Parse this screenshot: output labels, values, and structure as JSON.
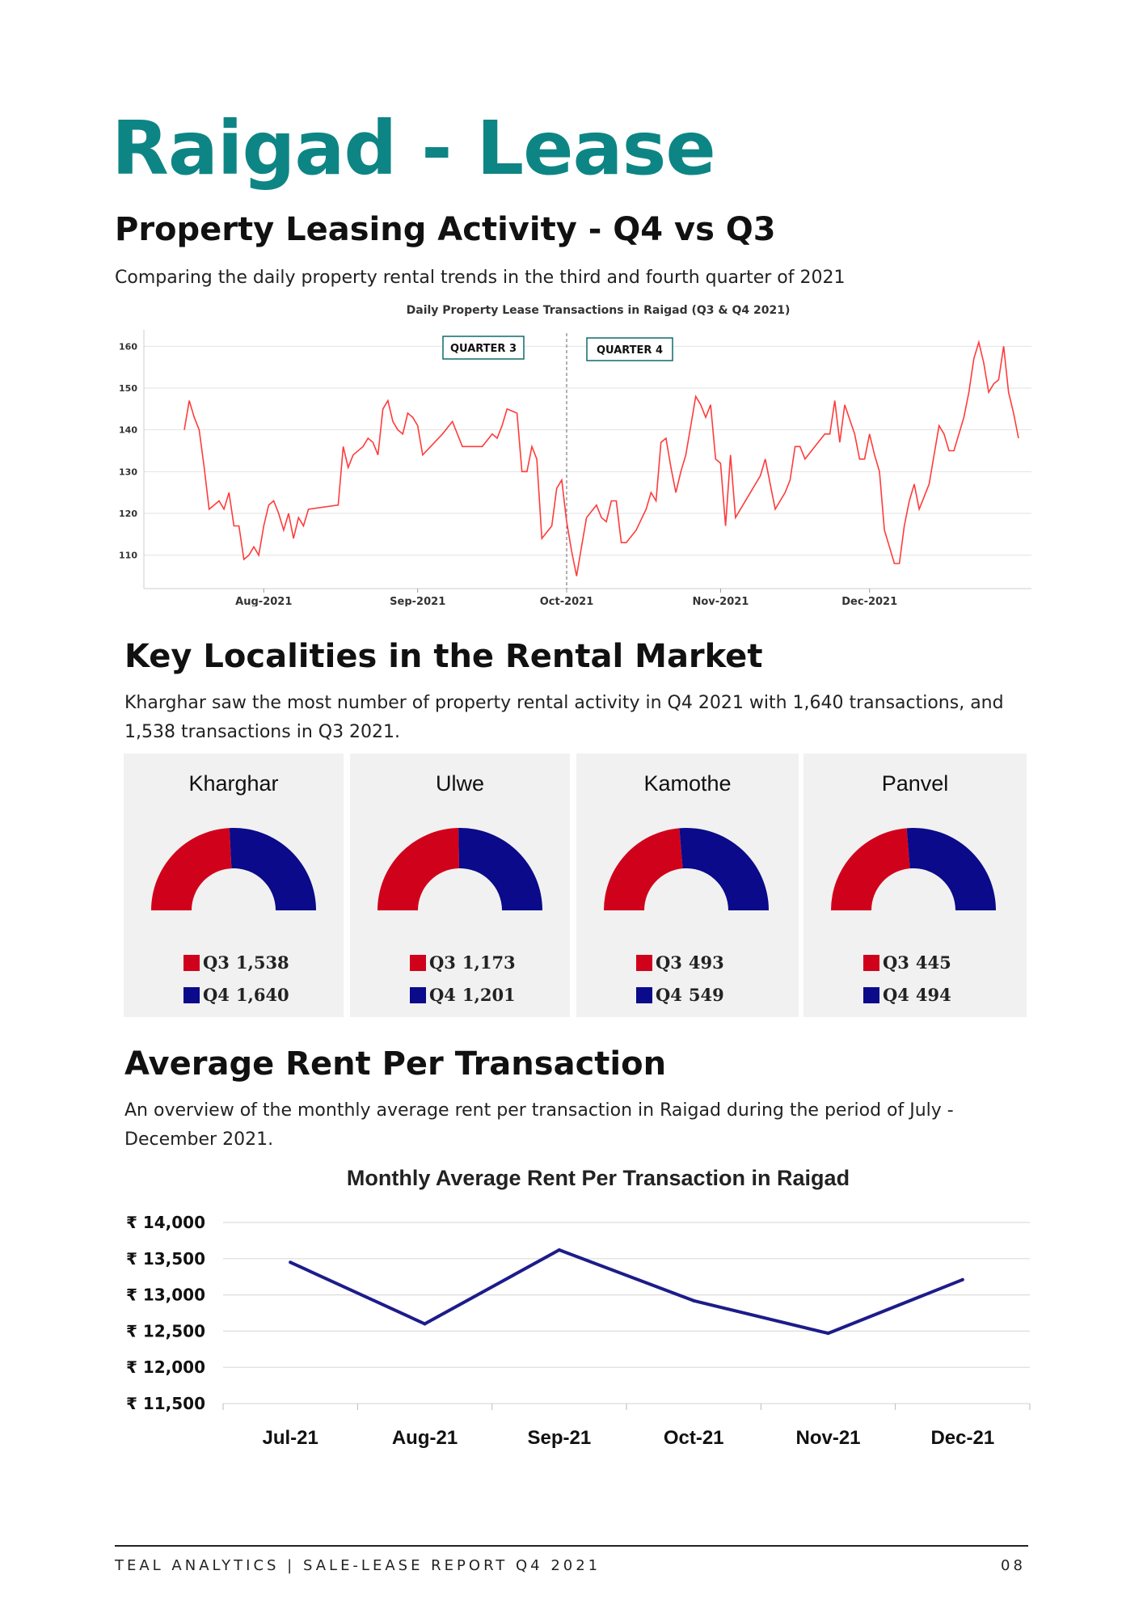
{
  "page": {
    "title": "Raigad - Lease",
    "footer_left": "TEAL ANALYTICS | SALE-LEASE REPORT Q4 2021",
    "page_number": "08",
    "accent_color": "#0e8585"
  },
  "section1": {
    "title": "Property Leasing Activity - Q4 vs Q3",
    "description": "Comparing the daily property rental trends in the third and fourth quarter of 2021"
  },
  "section2": {
    "title": "Key Localities in the Rental Market",
    "description": "Kharghar saw the most number of property rental activity in Q4 2021 with 1,640 transactions, and 1,538 transactions in Q3 2021."
  },
  "section3": {
    "title": "Average Rent Per Transaction",
    "description": "An overview of the monthly average rent per transaction in Raigad during the period of July - December 2021."
  },
  "localities": [
    {
      "name": "Kharghar",
      "q3_label": "Q3",
      "q4_label": "Q4",
      "q3_display": "1,538",
      "q4_display": "1,640",
      "q3": 1538,
      "q4": 1640
    },
    {
      "name": "Ulwe",
      "q3_label": "Q3",
      "q4_label": "Q4",
      "q3_display": "1,173",
      "q4_display": "1,201",
      "q3": 1173,
      "q4": 1201
    },
    {
      "name": "Kamothe",
      "q3_label": "Q3",
      "q4_label": "Q4",
      "q3_display": "493",
      "q4_display": "549",
      "q3": 493,
      "q4": 549
    },
    {
      "name": "Panvel",
      "q3_label": "Q3",
      "q4_label": "Q4",
      "q3_display": "445",
      "q4_display": "494",
      "q3": 445,
      "q4": 494
    }
  ],
  "chart_data": [
    {
      "type": "line",
      "title": "Daily Property Lease Transactions in Raigad (Q3 & Q4 2021)",
      "x_start": "2021-07-16",
      "x_end": "2021-12-31",
      "x_tick_labels": [
        "Aug-2021",
        "Sep-2021",
        "Oct-2021",
        "Nov-2021",
        "Dec-2021"
      ],
      "x_tick_dates": [
        "2021-08-01",
        "2021-09-01",
        "2021-10-01",
        "2021-11-01",
        "2021-12-01"
      ],
      "ylim": [
        102,
        162
      ],
      "yticks": [
        110,
        120,
        130,
        140,
        150,
        160
      ],
      "grid": true,
      "line_color": "#ff3b3b",
      "divider_date": "2021-10-01",
      "annotations": [
        "QUARTER 3",
        "QUARTER 4"
      ],
      "points": [
        [
          "2021-07-16",
          140
        ],
        [
          "2021-07-17",
          147
        ],
        [
          "2021-07-18",
          143
        ],
        [
          "2021-07-19",
          140
        ],
        [
          "2021-07-20",
          131
        ],
        [
          "2021-07-21",
          121
        ],
        [
          "2021-07-22",
          122
        ],
        [
          "2021-07-23",
          123
        ],
        [
          "2021-07-24",
          121
        ],
        [
          "2021-07-25",
          125
        ],
        [
          "2021-07-26",
          117
        ],
        [
          "2021-07-27",
          117
        ],
        [
          "2021-07-28",
          109
        ],
        [
          "2021-07-29",
          110
        ],
        [
          "2021-07-30",
          112
        ],
        [
          "2021-07-31",
          110
        ],
        [
          "2021-08-01",
          117
        ],
        [
          "2021-08-02",
          122
        ],
        [
          "2021-08-03",
          123
        ],
        [
          "2021-08-04",
          120
        ],
        [
          "2021-08-05",
          116
        ],
        [
          "2021-08-06",
          120
        ],
        [
          "2021-08-07",
          114
        ],
        [
          "2021-08-08",
          119
        ],
        [
          "2021-08-09",
          117
        ],
        [
          "2021-08-10",
          121
        ],
        [
          "2021-08-16",
          122
        ],
        [
          "2021-08-17",
          136
        ],
        [
          "2021-08-18",
          131
        ],
        [
          "2021-08-19",
          134
        ],
        [
          "2021-08-21",
          136
        ],
        [
          "2021-08-22",
          138
        ],
        [
          "2021-08-23",
          137
        ],
        [
          "2021-08-24",
          134
        ],
        [
          "2021-08-25",
          145
        ],
        [
          "2021-08-26",
          147
        ],
        [
          "2021-08-27",
          142
        ],
        [
          "2021-08-28",
          140
        ],
        [
          "2021-08-29",
          139
        ],
        [
          "2021-08-30",
          144
        ],
        [
          "2021-08-31",
          143
        ],
        [
          "2021-09-01",
          141
        ],
        [
          "2021-09-02",
          134
        ],
        [
          "2021-09-06",
          139
        ],
        [
          "2021-09-08",
          142
        ],
        [
          "2021-09-10",
          136
        ],
        [
          "2021-09-14",
          136
        ],
        [
          "2021-09-16",
          139
        ],
        [
          "2021-09-17",
          138
        ],
        [
          "2021-09-18",
          141
        ],
        [
          "2021-09-19",
          145
        ],
        [
          "2021-09-21",
          144
        ],
        [
          "2021-09-22",
          130
        ],
        [
          "2021-09-23",
          130
        ],
        [
          "2021-09-24",
          136
        ],
        [
          "2021-09-25",
          133
        ],
        [
          "2021-09-26",
          114
        ],
        [
          "2021-09-28",
          117
        ],
        [
          "2021-09-29",
          126
        ],
        [
          "2021-09-30",
          128
        ],
        [
          "2021-10-01",
          118
        ],
        [
          "2021-10-02",
          111
        ],
        [
          "2021-10-03",
          105
        ],
        [
          "2021-10-04",
          112
        ],
        [
          "2021-10-05",
          119
        ],
        [
          "2021-10-07",
          122
        ],
        [
          "2021-10-08",
          119
        ],
        [
          "2021-10-09",
          118
        ],
        [
          "2021-10-10",
          123
        ],
        [
          "2021-10-11",
          123
        ],
        [
          "2021-10-12",
          113
        ],
        [
          "2021-10-13",
          113
        ],
        [
          "2021-10-15",
          116
        ],
        [
          "2021-10-17",
          121
        ],
        [
          "2021-10-18",
          125
        ],
        [
          "2021-10-19",
          123
        ],
        [
          "2021-10-20",
          137
        ],
        [
          "2021-10-21",
          138
        ],
        [
          "2021-10-22",
          131
        ],
        [
          "2021-10-23",
          125
        ],
        [
          "2021-10-24",
          130
        ],
        [
          "2021-10-25",
          134
        ],
        [
          "2021-10-26",
          141
        ],
        [
          "2021-10-27",
          148
        ],
        [
          "2021-10-28",
          146
        ],
        [
          "2021-10-29",
          143
        ],
        [
          "2021-10-30",
          146
        ],
        [
          "2021-10-31",
          133
        ],
        [
          "2021-11-01",
          132
        ],
        [
          "2021-11-02",
          117
        ],
        [
          "2021-11-03",
          134
        ],
        [
          "2021-11-04",
          119
        ],
        [
          "2021-11-05",
          121
        ],
        [
          "2021-11-07",
          125
        ],
        [
          "2021-11-09",
          129
        ],
        [
          "2021-11-10",
          133
        ],
        [
          "2021-11-12",
          121
        ],
        [
          "2021-11-14",
          125
        ],
        [
          "2021-11-15",
          128
        ],
        [
          "2021-11-16",
          136
        ],
        [
          "2021-11-17",
          136
        ],
        [
          "2021-11-18",
          133
        ],
        [
          "2021-11-20",
          136
        ],
        [
          "2021-11-22",
          139
        ],
        [
          "2021-11-23",
          139
        ],
        [
          "2021-11-24",
          147
        ],
        [
          "2021-11-25",
          137
        ],
        [
          "2021-11-26",
          146
        ],
        [
          "2021-11-28",
          139
        ],
        [
          "2021-11-29",
          133
        ],
        [
          "2021-11-30",
          133
        ],
        [
          "2021-12-01",
          139
        ],
        [
          "2021-12-02",
          134
        ],
        [
          "2021-12-03",
          130
        ],
        [
          "2021-12-04",
          116
        ],
        [
          "2021-12-05",
          112
        ],
        [
          "2021-12-06",
          108
        ],
        [
          "2021-12-07",
          108
        ],
        [
          "2021-12-08",
          117
        ],
        [
          "2021-12-09",
          123
        ],
        [
          "2021-12-10",
          127
        ],
        [
          "2021-12-11",
          121
        ],
        [
          "2021-12-12",
          124
        ],
        [
          "2021-12-13",
          127
        ],
        [
          "2021-12-15",
          141
        ],
        [
          "2021-12-16",
          139
        ],
        [
          "2021-12-17",
          135
        ],
        [
          "2021-12-18",
          135
        ],
        [
          "2021-12-20",
          143
        ],
        [
          "2021-12-21",
          149
        ],
        [
          "2021-12-22",
          157
        ],
        [
          "2021-12-23",
          161
        ],
        [
          "2021-12-24",
          156
        ],
        [
          "2021-12-25",
          149
        ],
        [
          "2021-12-26",
          151
        ],
        [
          "2021-12-27",
          152
        ],
        [
          "2021-12-28",
          160
        ],
        [
          "2021-12-29",
          149
        ],
        [
          "2021-12-30",
          144
        ],
        [
          "2021-12-31",
          138
        ]
      ]
    },
    {
      "type": "line",
      "title": "Monthly Average Rent Per Transaction in Raigad",
      "categories": [
        "Jul-21",
        "Aug-21",
        "Sep-21",
        "Oct-21",
        "Nov-21",
        "Dec-21"
      ],
      "values": [
        13450,
        12600,
        13620,
        12920,
        12470,
        13210
      ],
      "ylim": [
        11500,
        14000
      ],
      "yticks": [
        11500,
        12000,
        12500,
        13000,
        13500,
        14000
      ],
      "y_tick_labels": [
        "₹ 11,500",
        "₹ 12,000",
        "₹ 12,500",
        "₹ 13,000",
        "₹ 13,500",
        "₹ 14,000"
      ],
      "grid": true,
      "line_color": "#1c1c8a"
    },
    {
      "type": "pie",
      "note_type": "half-donut",
      "series": [
        {
          "name": "Q3",
          "color": "#d0021b"
        },
        {
          "name": "Q4",
          "color": "#0a0a8a"
        }
      ]
    }
  ]
}
